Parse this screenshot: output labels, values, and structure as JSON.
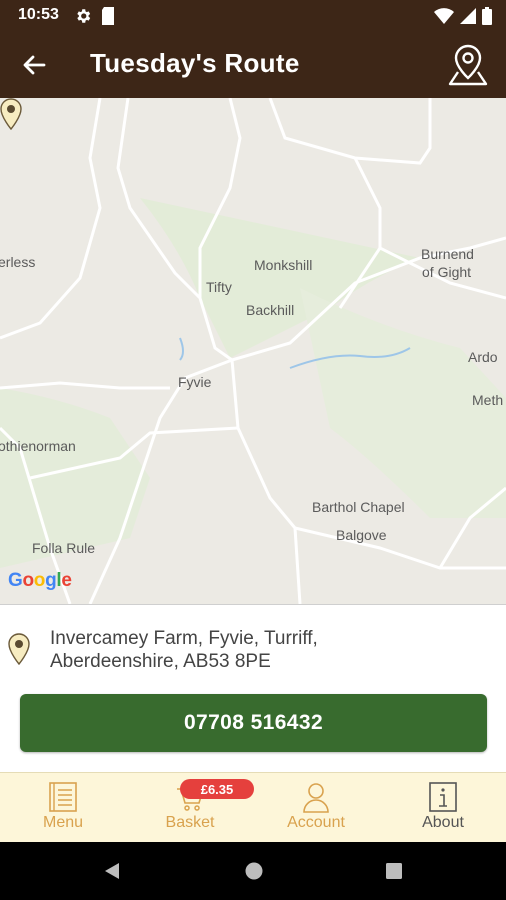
{
  "status_bar": {
    "time": "10:53",
    "left_icons": [
      "gear-icon",
      "sim-card-icon"
    ],
    "right_icons": [
      "wifi-icon",
      "signal-icon",
      "battery-icon"
    ]
  },
  "app_bar": {
    "title": "Tuesday's Route",
    "back_icon": "arrow-left-icon",
    "action_icon": "map-pin-outline-icon",
    "background": "#3d2617"
  },
  "map": {
    "places": [
      "erless",
      "Monkshill",
      "Burnend",
      "of Gight",
      "Tifty",
      "Backhill",
      "Ardo",
      "Fyvie",
      "Meth",
      "othienorman",
      "Barthol Chapel",
      "Balgove",
      "Folla Rule"
    ],
    "attribution": "Google"
  },
  "location": {
    "address_line1": "Invercamey Farm, Fyvie, Turriff,",
    "address_line2": "Aberdeenshire, AB53 8PE",
    "phone": "07708 516432",
    "button_color": "#386b2e"
  },
  "bottom_nav": {
    "items": [
      {
        "label": "Menu",
        "icon": "menu-book-icon"
      },
      {
        "label": "Basket",
        "icon": "cart-icon"
      },
      {
        "label": "Account",
        "icon": "user-icon"
      },
      {
        "label": "About",
        "icon": "info-icon"
      }
    ],
    "basket_badge": "£6.35",
    "active_color": "#d9a24e",
    "badge_color": "#e5403d"
  },
  "system_nav": [
    "back-triangle-icon",
    "home-circle-icon",
    "recents-square-icon"
  ]
}
